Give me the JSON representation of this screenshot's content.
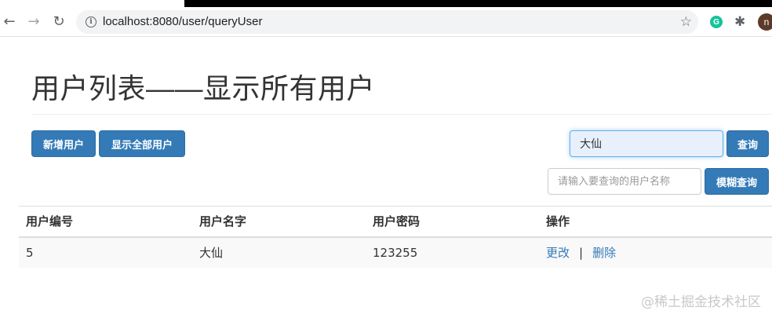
{
  "browser": {
    "url": "localhost:8080/user/queryUser",
    "avatar_initial": "n"
  },
  "page": {
    "title": "用户列表——显示所有用户"
  },
  "toolbar": {
    "add_label": "新增用户",
    "show_all_label": "显示全部用户",
    "query_value": "大仙",
    "query_label": "查询",
    "fuzzy_placeholder": "请输入要查询的用户名称",
    "fuzzy_label": "模糊查询"
  },
  "table": {
    "headers": [
      "用户编号",
      "用户名字",
      "用户密码",
      "操作"
    ],
    "rows": [
      {
        "id": "5",
        "name": "大仙",
        "password": "123255",
        "edit": "更改",
        "sep": "|",
        "delete": "删除"
      }
    ]
  },
  "watermark": "@稀土掘金技术社区",
  "colors": {
    "primary": "#337ab7",
    "link": "#337ab7",
    "row_bg": "#f9f9f9"
  }
}
